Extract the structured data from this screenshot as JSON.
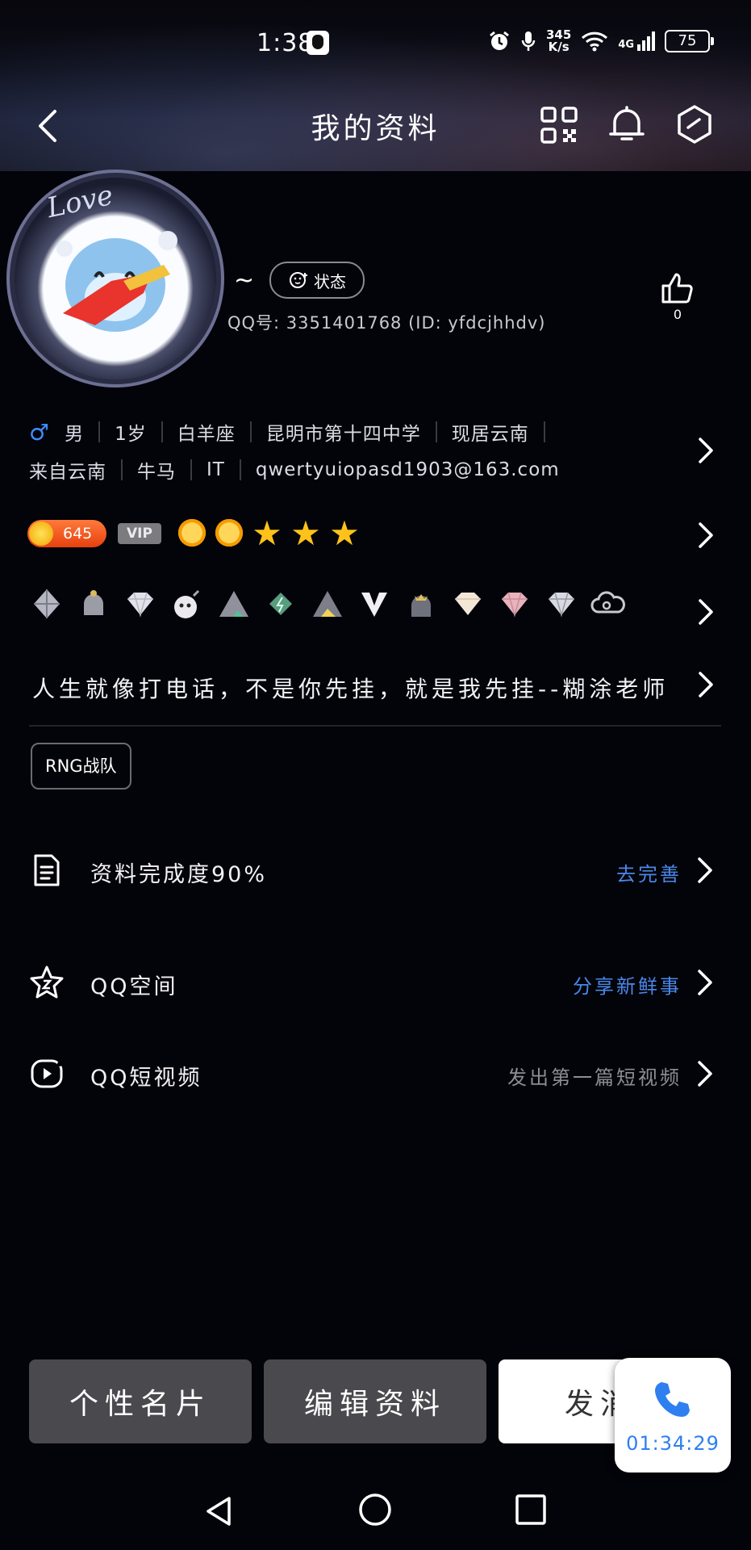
{
  "status_bar": {
    "time": "1:38",
    "net_speed_value": "345",
    "net_speed_unit": "K/s",
    "network": "4G",
    "battery": "75"
  },
  "header": {
    "title": "我的资料"
  },
  "profile": {
    "nickname": "~",
    "status_label": "状态",
    "qq_id_line": "QQ号: 3351401768 (ID: yfdcjhhdv)",
    "like_count": "0"
  },
  "info": {
    "row1": [
      "男",
      "1岁",
      "白羊座",
      "昆明市第十四中学",
      "现居云南"
    ],
    "row2": [
      "来自云南",
      "牛马",
      "IT",
      "qwertyuiopasd1903@163.com"
    ]
  },
  "level": {
    "number": "645",
    "vip_label": "VIP"
  },
  "signature": "人生就像打电话，不是你先挂，就是我先挂--糊涂老师",
  "tags": [
    "RNG战队"
  ],
  "rows": {
    "completion": {
      "label": "资料完成度90%",
      "action": "去完善",
      "action_color": "#4a88e8"
    },
    "qzone": {
      "label": "QQ空间",
      "action": "分享新鲜事",
      "action_color": "#4a88e8"
    },
    "short_video": {
      "label": "QQ短视频",
      "action": "发出第一篇短视频",
      "action_color": "#8d8d96"
    }
  },
  "buttons": {
    "card": "个性名片",
    "edit": "编辑资料",
    "message": "发消"
  },
  "call": {
    "duration": "01:34:29"
  },
  "colors": {
    "accent_blue": "#4a88e8",
    "male_blue": "#3f8cff",
    "background": "#03030a"
  }
}
